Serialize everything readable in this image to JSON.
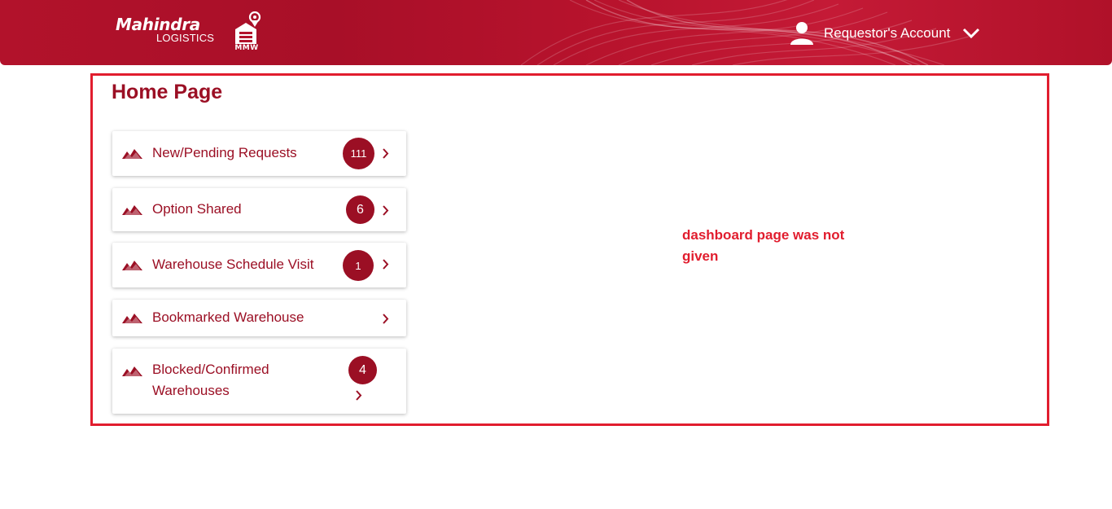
{
  "header": {
    "logo_brand": "Mahindra",
    "logo_sub": "LOGISTICS",
    "logo_badge": "MMW",
    "account_label": "Requestor's Account",
    "icons": {
      "user": "user-icon",
      "dropdown": "chevron-down-icon"
    }
  },
  "main": {
    "title": "Home Page",
    "cards": [
      {
        "label": "New/Pending Requests",
        "count": "111",
        "icon": "mountain-icon"
      },
      {
        "label": "Option Shared",
        "count": "6",
        "icon": "mountain-icon"
      },
      {
        "label": "Warehouse Schedule Visit",
        "count": "1",
        "icon": "mountain-icon"
      },
      {
        "label": "Bookmarked Warehouse",
        "count": "",
        "icon": "mountain-icon"
      },
      {
        "label": "Blocked/Confirmed Warehouses",
        "label_line1": "Blocked/Confirmed",
        "label_line2": "Warehouses",
        "count": "4",
        "icon": "mountain-icon"
      }
    ]
  },
  "annotation": {
    "line1": "dashboard page was not",
    "line2": "given"
  },
  "colors": {
    "brand": "#9b0f24",
    "header": "#b2122b",
    "annotation": "#e11d2e"
  }
}
